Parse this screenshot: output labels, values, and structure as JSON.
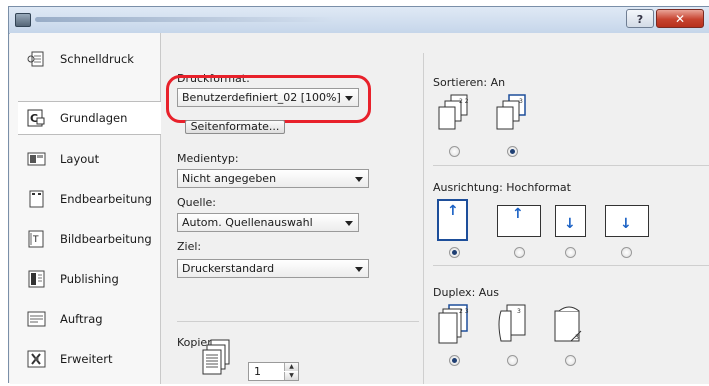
{
  "window": {
    "help_label": "?",
    "close_label": "✕"
  },
  "sidebar": {
    "items": [
      {
        "label": "Schnelldruck",
        "icon": "quick-print-icon"
      },
      {
        "label": "Grundlagen",
        "icon": "basics-icon",
        "selected": true
      },
      {
        "label": "Layout",
        "icon": "layout-icon"
      },
      {
        "label": "Endbearbeitung",
        "icon": "finishing-icon"
      },
      {
        "label": "Bildbearbeitung",
        "icon": "image-icon"
      },
      {
        "label": "Publishing",
        "icon": "publishing-icon"
      },
      {
        "label": "Auftrag",
        "icon": "job-icon"
      },
      {
        "label": "Erweitert",
        "icon": "advanced-icon"
      }
    ]
  },
  "main": {
    "druckformat_label": "Druckformat:",
    "druckformat_value": "Benutzerdefiniert_02 [100%]",
    "seitenformate_button": "Seitenformate...",
    "medientyp_label": "Medientyp:",
    "medientyp_value": "Nicht angegeben",
    "quelle_label": "Quelle:",
    "quelle_value": "Autom. Quellenauswahl",
    "ziel_label": "Ziel:",
    "ziel_value": "Druckerstandard",
    "kopien_label": "Kopien:",
    "kopien_value": "1",
    "sortieren_label": "Sortieren:  An",
    "ausrichtung_label": "Ausrichtung:  Hochformat",
    "duplex_label": "Duplex:  Aus"
  },
  "colors": {
    "highlight": "#e8212b",
    "selected_border": "#1d4e9a",
    "arrow": "#1c62c5"
  }
}
